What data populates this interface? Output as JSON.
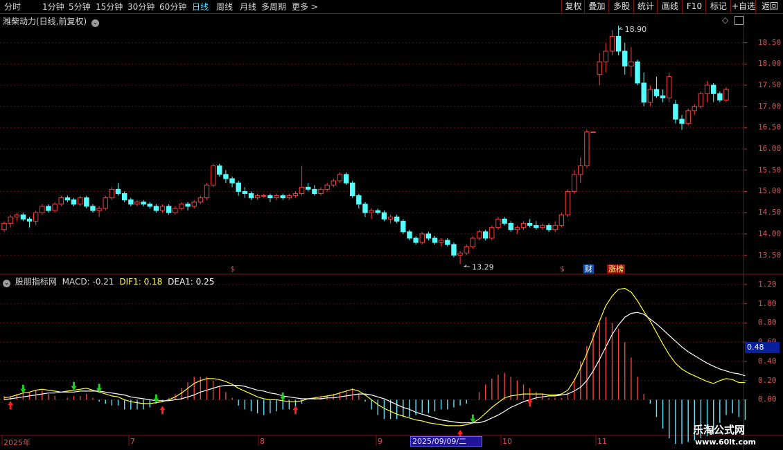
{
  "toolbar": {
    "periods": [
      "分时",
      "1分钟",
      "5分钟",
      "15分钟",
      "30分钟",
      "60分钟",
      "日线",
      "周线",
      "月线",
      "多周期",
      "更多 >"
    ],
    "active_period": "日线",
    "right_buttons": [
      "复权",
      "叠加",
      "多股",
      "统计",
      "画线",
      "F10",
      "标记",
      "+自选",
      "返回"
    ]
  },
  "main_chart": {
    "title": "潍柴动力(日线,前复权)",
    "high_label": "18.90",
    "low_label": "13.29",
    "y_labels": [
      "18.50",
      "18.00",
      "17.50",
      "17.00",
      "16.50",
      "16.00",
      "15.50",
      "15.00",
      "14.50",
      "14.00",
      "13.50"
    ],
    "markers": [
      {
        "text": "$",
        "color": "#ff3030"
      },
      {
        "text": "$",
        "color": "#ff3030"
      },
      {
        "text": "财",
        "color": "#ffffff",
        "bg": "#1450a8"
      },
      {
        "text": "涨榜",
        "color": "#ffff80",
        "bg": "#a01010"
      }
    ]
  },
  "macd_panel": {
    "indicator_name": "股朋指标网",
    "macd_label": "MACD: -0.21",
    "dif_label": "DIF1: 0.18",
    "dea_label": "DEA1: 0.25",
    "y_labels": [
      "1.20",
      "1.00",
      "0.80",
      "0.60",
      "0.40",
      "0.20",
      "0.00"
    ],
    "current_value": "0.48"
  },
  "date_axis": {
    "labels": [
      "2025年",
      "7",
      "8",
      "9",
      "10",
      "11"
    ],
    "cursor_date": "2025/09/09/二"
  },
  "watermark": {
    "name": "乐淘公式网",
    "url": "www.60lt.com"
  },
  "chart_data": {
    "type": "candlestick",
    "title": "潍柴动力(日线,前复权)",
    "y_range": [
      13.2,
      18.95
    ],
    "ohlc": [
      [
        14.1,
        14.3,
        14.05,
        14.25
      ],
      [
        14.25,
        14.45,
        14.15,
        14.4
      ],
      [
        14.4,
        14.5,
        14.3,
        14.45
      ],
      [
        14.45,
        14.5,
        14.3,
        14.35
      ],
      [
        14.35,
        14.4,
        14.15,
        14.3
      ],
      [
        14.3,
        14.55,
        14.2,
        14.5
      ],
      [
        14.5,
        14.7,
        14.45,
        14.65
      ],
      [
        14.65,
        14.7,
        14.5,
        14.55
      ],
      [
        14.55,
        14.75,
        14.5,
        14.7
      ],
      [
        14.7,
        14.9,
        14.65,
        14.85
      ],
      [
        14.85,
        14.9,
        14.75,
        14.8
      ],
      [
        14.8,
        14.85,
        14.65,
        14.7
      ],
      [
        14.7,
        14.9,
        14.65,
        14.85
      ],
      [
        14.85,
        14.9,
        14.6,
        14.65
      ],
      [
        14.65,
        14.7,
        14.5,
        14.55
      ],
      [
        14.55,
        14.65,
        14.4,
        14.6
      ],
      [
        14.6,
        14.9,
        14.55,
        14.85
      ],
      [
        14.85,
        15.1,
        14.8,
        15.05
      ],
      [
        15.05,
        15.2,
        14.9,
        14.95
      ],
      [
        14.95,
        15.0,
        14.75,
        14.8
      ],
      [
        14.8,
        14.85,
        14.65,
        14.7
      ],
      [
        14.7,
        14.8,
        14.65,
        14.75
      ],
      [
        14.75,
        14.8,
        14.65,
        14.7
      ],
      [
        14.7,
        14.75,
        14.6,
        14.65
      ],
      [
        14.65,
        14.7,
        14.5,
        14.55
      ],
      [
        14.55,
        14.7,
        14.5,
        14.65
      ],
      [
        14.65,
        14.7,
        14.45,
        14.5
      ],
      [
        14.5,
        14.65,
        14.45,
        14.6
      ],
      [
        14.6,
        14.75,
        14.55,
        14.7
      ],
      [
        14.7,
        14.75,
        14.55,
        14.65
      ],
      [
        14.65,
        14.8,
        14.6,
        14.75
      ],
      [
        14.75,
        14.9,
        14.7,
        14.85
      ],
      [
        14.85,
        15.2,
        14.8,
        15.15
      ],
      [
        15.15,
        15.65,
        15.1,
        15.6
      ],
      [
        15.6,
        15.65,
        15.35,
        15.4
      ],
      [
        15.4,
        15.5,
        15.2,
        15.3
      ],
      [
        15.3,
        15.35,
        15.1,
        15.2
      ],
      [
        15.2,
        15.25,
        14.9,
        15.0
      ],
      [
        15.0,
        15.1,
        14.85,
        14.95
      ],
      [
        14.95,
        15.0,
        14.8,
        14.85
      ],
      [
        14.85,
        14.95,
        14.8,
        14.9
      ],
      [
        14.9,
        14.95,
        14.85,
        14.9
      ],
      [
        14.9,
        14.95,
        14.75,
        14.85
      ],
      [
        14.85,
        14.95,
        14.8,
        14.9
      ],
      [
        14.9,
        14.95,
        14.8,
        14.85
      ],
      [
        14.85,
        14.95,
        14.8,
        14.9
      ],
      [
        14.9,
        15.0,
        14.85,
        14.95
      ],
      [
        14.95,
        15.6,
        14.9,
        15.1
      ],
      [
        15.1,
        15.2,
        15.0,
        15.05
      ],
      [
        15.05,
        15.15,
        14.9,
        14.95
      ],
      [
        14.95,
        15.1,
        14.9,
        15.05
      ],
      [
        15.05,
        15.2,
        15.0,
        15.15
      ],
      [
        15.15,
        15.3,
        15.1,
        15.25
      ],
      [
        15.25,
        15.45,
        15.2,
        15.4
      ],
      [
        15.4,
        15.45,
        15.15,
        15.2
      ],
      [
        15.2,
        15.25,
        14.85,
        14.9
      ],
      [
        14.9,
        14.95,
        14.6,
        14.7
      ],
      [
        14.7,
        14.75,
        14.4,
        14.5
      ],
      [
        14.5,
        14.6,
        14.35,
        14.55
      ],
      [
        14.55,
        14.6,
        14.45,
        14.5
      ],
      [
        14.5,
        14.55,
        14.3,
        14.35
      ],
      [
        14.35,
        14.45,
        14.25,
        14.4
      ],
      [
        14.4,
        14.45,
        14.25,
        14.3
      ],
      [
        14.3,
        14.35,
        14.0,
        14.05
      ],
      [
        14.05,
        14.1,
        13.85,
        13.9
      ],
      [
        13.9,
        13.95,
        13.75,
        13.8
      ],
      [
        13.8,
        14.05,
        13.75,
        14.0
      ],
      [
        14.0,
        14.05,
        13.85,
        13.9
      ],
      [
        13.9,
        13.95,
        13.75,
        13.8
      ],
      [
        13.8,
        13.9,
        13.7,
        13.85
      ],
      [
        13.85,
        13.9,
        13.7,
        13.75
      ],
      [
        13.75,
        13.8,
        13.45,
        13.5
      ],
      [
        13.5,
        13.6,
        13.29,
        13.55
      ],
      [
        13.55,
        13.75,
        13.5,
        13.7
      ],
      [
        13.7,
        13.95,
        13.65,
        13.9
      ],
      [
        13.9,
        14.1,
        13.85,
        14.05
      ],
      [
        14.05,
        14.1,
        13.85,
        13.9
      ],
      [
        13.9,
        14.2,
        13.85,
        14.15
      ],
      [
        14.15,
        14.4,
        14.1,
        14.35
      ],
      [
        14.35,
        14.4,
        14.2,
        14.25
      ],
      [
        14.25,
        14.3,
        14.05,
        14.1
      ],
      [
        14.1,
        14.2,
        14.0,
        14.15
      ],
      [
        14.15,
        14.3,
        14.1,
        14.25
      ],
      [
        14.25,
        14.35,
        14.15,
        14.2
      ],
      [
        14.2,
        14.3,
        14.1,
        14.15
      ],
      [
        14.15,
        14.25,
        14.1,
        14.2
      ],
      [
        14.2,
        14.25,
        14.05,
        14.1
      ],
      [
        14.1,
        14.3,
        14.05,
        14.2
      ],
      [
        14.2,
        14.5,
        14.15,
        14.45
      ],
      [
        14.45,
        15.05,
        14.4,
        15.0
      ],
      [
        15.0,
        15.5,
        14.95,
        15.4
      ],
      [
        15.4,
        15.8,
        15.2,
        15.6
      ],
      [
        15.6,
        16.45,
        15.55,
        16.4
      ],
      [
        16.4,
        16.4,
        16.4,
        16.4
      ],
      [
        17.75,
        18.25,
        17.5,
        18.05
      ],
      [
        18.05,
        18.5,
        17.8,
        18.3
      ],
      [
        18.3,
        18.8,
        18.2,
        18.65
      ],
      [
        18.65,
        18.9,
        18.2,
        18.3
      ],
      [
        18.3,
        18.5,
        17.75,
        17.95
      ],
      [
        17.95,
        18.4,
        17.7,
        18.05
      ],
      [
        18.05,
        18.1,
        17.5,
        17.55
      ],
      [
        17.55,
        17.8,
        17.0,
        17.1
      ],
      [
        17.1,
        17.5,
        17.0,
        17.4
      ],
      [
        17.4,
        17.7,
        17.2,
        17.25
      ],
      [
        17.25,
        17.4,
        17.1,
        17.2
      ],
      [
        17.2,
        17.8,
        17.1,
        17.7
      ],
      [
        17.05,
        17.15,
        16.6,
        16.7
      ],
      [
        16.7,
        16.8,
        16.45,
        16.6
      ],
      [
        16.6,
        16.95,
        16.55,
        16.9
      ],
      [
        16.9,
        17.05,
        16.8,
        17.0
      ],
      [
        17.0,
        17.35,
        16.95,
        17.3
      ],
      [
        17.3,
        17.6,
        17.1,
        17.5
      ],
      [
        17.5,
        17.55,
        17.1,
        17.3
      ],
      [
        17.3,
        17.35,
        17.1,
        17.15
      ],
      [
        17.15,
        17.45,
        17.1,
        17.4
      ]
    ],
    "macd": {
      "y_range": [
        -0.35,
        1.25
      ],
      "dif": [
        0.02,
        0.03,
        0.05,
        0.07,
        0.08,
        0.1,
        0.11,
        0.1,
        0.09,
        0.08,
        0.09,
        0.1,
        0.11,
        0.12,
        0.1,
        0.08,
        0.06,
        0.04,
        0.03,
        0.0,
        -0.02,
        -0.03,
        -0.04,
        -0.04,
        -0.03,
        -0.02,
        0.0,
        0.03,
        0.07,
        0.12,
        0.17,
        0.2,
        0.22,
        0.22,
        0.21,
        0.19,
        0.16,
        0.12,
        0.09,
        0.06,
        0.03,
        0.01,
        0.0,
        0.0,
        -0.01,
        -0.02,
        -0.02,
        -0.01,
        0.01,
        0.02,
        0.03,
        0.04,
        0.05,
        0.07,
        0.09,
        0.11,
        0.09,
        0.05,
        0.0,
        -0.05,
        -0.09,
        -0.12,
        -0.15,
        -0.17,
        -0.19,
        -0.21,
        -0.22,
        -0.24,
        -0.25,
        -0.26,
        -0.27,
        -0.27,
        -0.27,
        -0.26,
        -0.24,
        -0.2,
        -0.14,
        -0.08,
        -0.03,
        0.02,
        0.04,
        0.05,
        0.06,
        0.06,
        0.06,
        0.06,
        0.05,
        0.05,
        0.06,
        0.1,
        0.2,
        0.33,
        0.48,
        0.65,
        0.82,
        0.98,
        1.08,
        1.15,
        1.16,
        1.12,
        1.03,
        0.92,
        0.82,
        0.7,
        0.58,
        0.47,
        0.38,
        0.32,
        0.28,
        0.25,
        0.22,
        0.19,
        0.17,
        0.2,
        0.22,
        0.21,
        0.18,
        0.18
      ],
      "dea": [
        0.0,
        0.01,
        0.02,
        0.03,
        0.04,
        0.05,
        0.06,
        0.07,
        0.07,
        0.08,
        0.08,
        0.08,
        0.09,
        0.09,
        0.09,
        0.09,
        0.08,
        0.07,
        0.06,
        0.05,
        0.03,
        0.02,
        0.01,
        0.0,
        -0.01,
        -0.01,
        -0.01,
        0.0,
        0.01,
        0.03,
        0.05,
        0.08,
        0.1,
        0.12,
        0.14,
        0.15,
        0.15,
        0.15,
        0.14,
        0.12,
        0.1,
        0.09,
        0.07,
        0.06,
        0.04,
        0.03,
        0.02,
        0.01,
        0.01,
        0.01,
        0.01,
        0.02,
        0.02,
        0.03,
        0.04,
        0.05,
        0.06,
        0.06,
        0.05,
        0.03,
        0.01,
        -0.02,
        -0.05,
        -0.08,
        -0.1,
        -0.13,
        -0.15,
        -0.17,
        -0.19,
        -0.21,
        -0.22,
        -0.23,
        -0.24,
        -0.24,
        -0.24,
        -0.24,
        -0.22,
        -0.19,
        -0.16,
        -0.12,
        -0.08,
        -0.05,
        -0.02,
        0.0,
        0.02,
        0.03,
        0.04,
        0.04,
        0.05,
        0.06,
        0.09,
        0.13,
        0.2,
        0.3,
        0.42,
        0.55,
        0.68,
        0.78,
        0.86,
        0.9,
        0.91,
        0.89,
        0.84,
        0.79,
        0.73,
        0.67,
        0.61,
        0.55,
        0.5,
        0.46,
        0.42,
        0.38,
        0.35,
        0.32,
        0.3,
        0.28,
        0.27,
        0.25
      ],
      "hist": [
        0.04,
        0.04,
        0.06,
        0.08,
        0.08,
        0.1,
        0.1,
        0.06,
        0.04,
        0.0,
        0.02,
        0.04,
        0.04,
        0.06,
        0.02,
        -0.02,
        -0.04,
        -0.06,
        -0.06,
        -0.1,
        -0.1,
        -0.1,
        -0.1,
        -0.08,
        -0.04,
        -0.02,
        0.02,
        0.06,
        0.12,
        0.18,
        0.24,
        0.24,
        0.24,
        0.2,
        0.14,
        0.08,
        0.02,
        -0.06,
        -0.1,
        -0.12,
        -0.14,
        -0.16,
        -0.14,
        -0.12,
        -0.1,
        -0.1,
        -0.08,
        -0.04,
        0.0,
        0.02,
        0.04,
        0.04,
        0.06,
        0.08,
        0.1,
        0.12,
        0.06,
        -0.02,
        -0.1,
        -0.16,
        -0.2,
        -0.2,
        -0.2,
        -0.18,
        -0.18,
        -0.16,
        -0.14,
        -0.14,
        -0.12,
        -0.1,
        -0.1,
        -0.08,
        -0.06,
        -0.04,
        0.0,
        0.08,
        0.16,
        0.22,
        0.26,
        0.28,
        0.24,
        0.2,
        0.16,
        0.12,
        0.08,
        0.06,
        0.02,
        0.02,
        0.02,
        0.08,
        0.22,
        0.4,
        0.56,
        0.7,
        0.8,
        0.86,
        0.8,
        0.74,
        0.6,
        0.44,
        0.24,
        0.06,
        -0.04,
        -0.18,
        -0.3,
        -0.4,
        -0.46,
        -0.46,
        -0.44,
        -0.42,
        -0.4,
        -0.38,
        -0.36,
        -0.24,
        -0.16,
        -0.14,
        -0.18,
        -0.21
      ],
      "buy_signals": [
        1,
        25,
        46,
        72,
        83
      ],
      "sell_signals": [
        3,
        11,
        15,
        24,
        44,
        74
      ]
    }
  }
}
